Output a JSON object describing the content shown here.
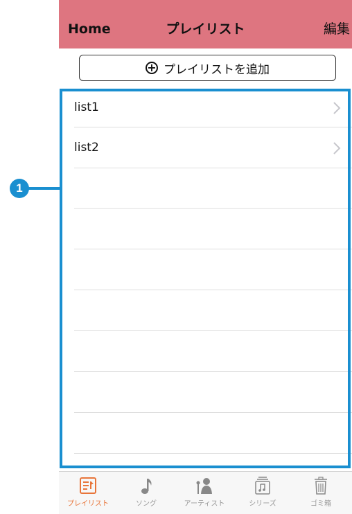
{
  "navbar": {
    "left": "Home",
    "title": "プレイリスト",
    "right": "編集"
  },
  "add_button": {
    "label": "プレイリストを追加"
  },
  "playlists": [
    {
      "name": "list1"
    },
    {
      "name": "list2"
    }
  ],
  "tabs": [
    {
      "label": "プレイリスト",
      "icon": "playlist-icon",
      "active": true
    },
    {
      "label": "ソング",
      "icon": "music-note-icon",
      "active": false
    },
    {
      "label": "アーティスト",
      "icon": "artist-icon",
      "active": false
    },
    {
      "label": "シリーズ",
      "icon": "series-icon",
      "active": false
    },
    {
      "label": "ゴミ箱",
      "icon": "trash-icon",
      "active": false
    }
  ],
  "callout": {
    "number": "1"
  },
  "colors": {
    "navbar": "#de7580",
    "accent": "#e8753a",
    "callout": "#1a8fd0"
  }
}
